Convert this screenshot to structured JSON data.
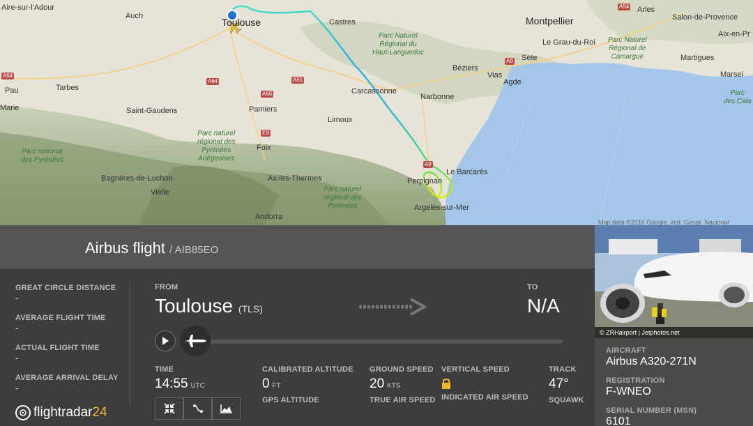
{
  "map": {
    "cities": [
      {
        "name": "Aire-sur-l'Adour",
        "big": false
      },
      {
        "name": "Auch",
        "big": false
      },
      {
        "name": "Toulouse",
        "big": true
      },
      {
        "name": "Castres",
        "big": false
      },
      {
        "name": "Montpellier",
        "big": true
      },
      {
        "name": "Arles",
        "big": false
      },
      {
        "name": "Salon-de-Provence",
        "big": false
      },
      {
        "name": "Aix-en-Pr",
        "big": false
      },
      {
        "name": "Le Grau-du-Roi",
        "big": false
      },
      {
        "name": "Sète",
        "big": false
      },
      {
        "name": "Martigues",
        "big": false
      },
      {
        "name": "Marsei",
        "big": false
      },
      {
        "name": "Pau",
        "big": false
      },
      {
        "name": "Tarbes",
        "big": false
      },
      {
        "name": "Béziers",
        "big": false
      },
      {
        "name": "Vias",
        "big": false
      },
      {
        "name": "Agde",
        "big": false
      },
      {
        "name": "Carcassonne",
        "big": false
      },
      {
        "name": "Narbonne",
        "big": false
      },
      {
        "name": "Marie",
        "big": false
      },
      {
        "name": "Saint-Gaudens",
        "big": false
      },
      {
        "name": "Pamiers",
        "big": false
      },
      {
        "name": "Limoux",
        "big": false
      },
      {
        "name": "Foix",
        "big": false
      },
      {
        "name": "Le Barcarès",
        "big": false
      },
      {
        "name": "Perpignan",
        "big": false
      },
      {
        "name": "Bagnères-de-Luchon",
        "big": false
      },
      {
        "name": "Vielle",
        "big": false
      },
      {
        "name": "Ax-les-Thermes",
        "big": false
      },
      {
        "name": "Argelès-sur-Mer",
        "big": false
      },
      {
        "name": "Andorra",
        "big": false
      }
    ],
    "parks": [
      "Parc Naturel\nRégional du\nHaut-Languedoc",
      "Parc naturel\nrégional des\nPyrénées\nAriégeoises",
      "Parc Naturel\nRégional de\nCamargue",
      "Parc national\ndes Pyrénées",
      "Parc naturel\nrégional des\nPyrénées",
      "Parc\ndes Cala"
    ],
    "roads": [
      "A54",
      "A9",
      "A64",
      "A64",
      "A61",
      "A66",
      "E9",
      "A9"
    ],
    "legal": "Map data ©2016 Google, Inst. Geogr. Nacional"
  },
  "header": {
    "title": "Airbus flight",
    "callsign": "/ AIB85EO"
  },
  "left_stats": [
    {
      "label": "GREAT CIRCLE DISTANCE",
      "value": "-"
    },
    {
      "label": "AVERAGE FLIGHT TIME",
      "value": "-"
    },
    {
      "label": "ACTUAL FLIGHT TIME",
      "value": "-"
    },
    {
      "label": "AVERAGE ARRIVAL DELAY",
      "value": "-"
    }
  ],
  "route": {
    "from_label": "FROM",
    "from_city": "Toulouse",
    "from_code": "(TLS)",
    "to_label": "TO",
    "to_value": "N/A",
    "progress": 0.0
  },
  "stats": {
    "time_label": "TIME",
    "time_value": "14:55",
    "time_unit": "UTC",
    "cal_alt_label": "CALIBRATED ALTITUDE",
    "cal_alt_value": "0",
    "cal_alt_unit": "FT",
    "gps_alt_label": "GPS ALTITUDE",
    "ground_speed_label": "GROUND SPEED",
    "ground_speed_value": "20",
    "ground_speed_unit": "KTS",
    "tas_label": "TRUE AIR SPEED",
    "vs_label": "VERTICAL SPEED",
    "ias_label": "INDICATED AIR SPEED",
    "track_label": "TRACK",
    "track_value": "47°",
    "squawk_label": "SQUAWK"
  },
  "logo": {
    "text": "flightradar",
    "num": "24"
  },
  "photo": {
    "credit": "© ZRHairport | Jetphotos.net"
  },
  "aircraft": {
    "type_label": "AIRCRAFT",
    "type_value": "Airbus A320-271N",
    "reg_label": "REGISTRATION",
    "reg_value": "F-WNEO",
    "msn_label": "SERIAL NUMBER (MSN)",
    "msn_value": "6101"
  },
  "colors": {
    "accent": "#f5b731",
    "track_start": "#2fb8e0",
    "track_end": "#d8f000",
    "sea": "#a3c6e9"
  }
}
